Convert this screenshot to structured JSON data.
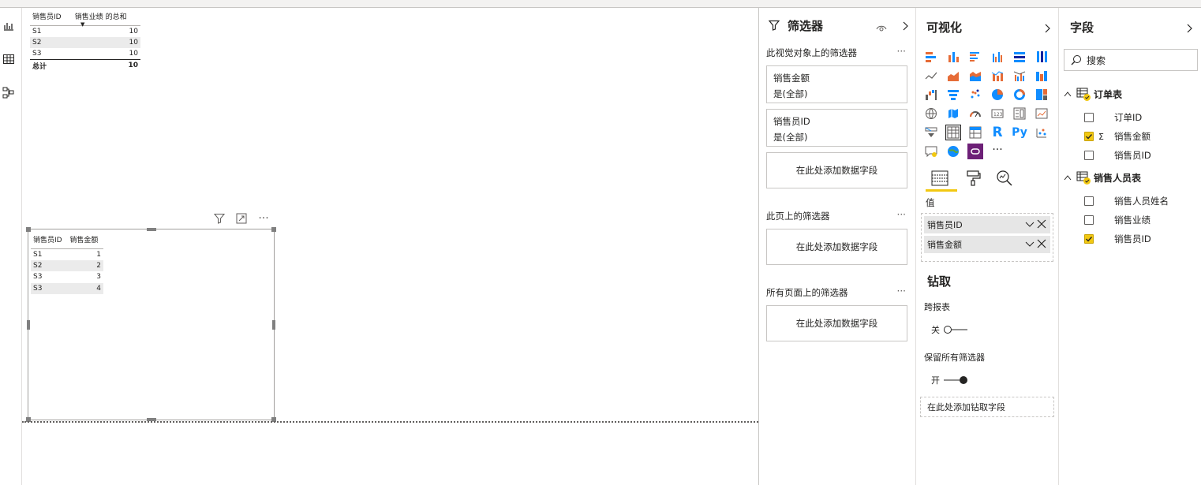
{
  "canvas": {
    "table1": {
      "headers": [
        "销售员ID",
        "销售业绩 的总和"
      ],
      "rows": [
        [
          "S1",
          "10"
        ],
        [
          "S2",
          "10"
        ],
        [
          "S3",
          "10"
        ]
      ],
      "total": [
        "总计",
        "10"
      ]
    },
    "table2": {
      "headers": [
        "销售员ID",
        "销售金额"
      ],
      "rows": [
        [
          "S1",
          "1"
        ],
        [
          "S2",
          "2"
        ],
        [
          "S3",
          "3"
        ],
        [
          "S3",
          "4"
        ]
      ]
    },
    "visual_header_more": "···"
  },
  "filters": {
    "title": "筛选器",
    "sections": {
      "visual": "此视觉对象上的筛选器",
      "page": "此页上的筛选器",
      "all": "所有页面上的筛选器"
    },
    "more": "···",
    "cards": [
      {
        "field": "销售金额",
        "state": "是(全部)"
      },
      {
        "field": "销售员ID",
        "state": "是(全部)"
      }
    ],
    "drop_label": "在此处添加数据字段"
  },
  "visualizations": {
    "title": "可视化",
    "more_visuals": "···",
    "values_label": "值",
    "value_fields": [
      "销售员ID",
      "销售金额"
    ],
    "drill_title": "钻取",
    "cross_report": "跨报表",
    "cross_report_state": "关",
    "keep_filters": "保留所有筛选器",
    "keep_filters_state": "开",
    "drill_drop": "在此处添加钻取字段",
    "colors": {
      "accent": "#f2c811"
    }
  },
  "fields": {
    "title": "字段",
    "search_placeholder": "搜索",
    "tables": [
      {
        "name": "订单表",
        "fields": [
          {
            "name": "订单ID",
            "checked": false,
            "sigma": false
          },
          {
            "name": "销售金额",
            "checked": true,
            "sigma": true
          },
          {
            "name": "销售员ID",
            "checked": false,
            "sigma": false
          }
        ]
      },
      {
        "name": "销售人员表",
        "fields": [
          {
            "name": "销售人员姓名",
            "checked": false,
            "sigma": false
          },
          {
            "name": "销售业绩",
            "checked": false,
            "sigma": false
          },
          {
            "name": "销售员ID",
            "checked": true,
            "sigma": false
          }
        ]
      }
    ]
  }
}
